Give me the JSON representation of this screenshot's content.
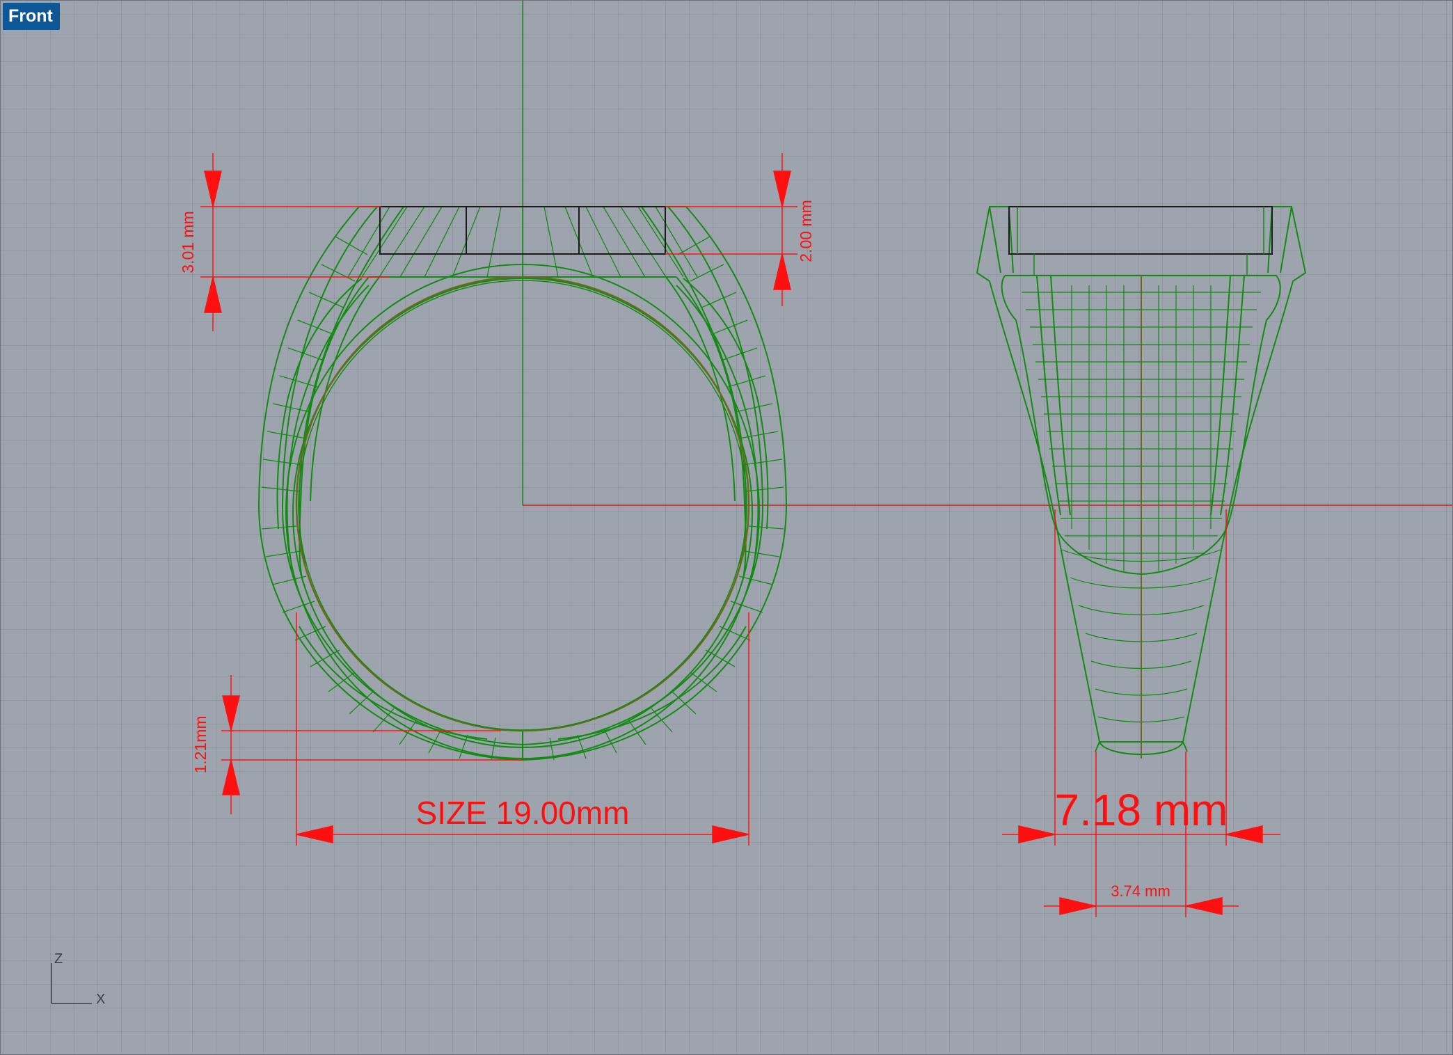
{
  "viewport": {
    "label": "Front"
  },
  "dimensions": {
    "top_height": "3.01 mm",
    "setting_depth": "2.00 mm",
    "bottom_thickness": "1.21mm",
    "ring_size": "SIZE 19.00mm",
    "top_width": "7.18 mm",
    "bottom_width": "3.74 mm"
  },
  "axes": {
    "z": "Z",
    "x": "X"
  },
  "colors": {
    "background": "#9ea4ae",
    "wireframe": "#138a13",
    "dimension": "#ff1010",
    "axis_x": "#d21818",
    "axis_z": "#1a8a1a",
    "label_bg": "#0d5796"
  }
}
